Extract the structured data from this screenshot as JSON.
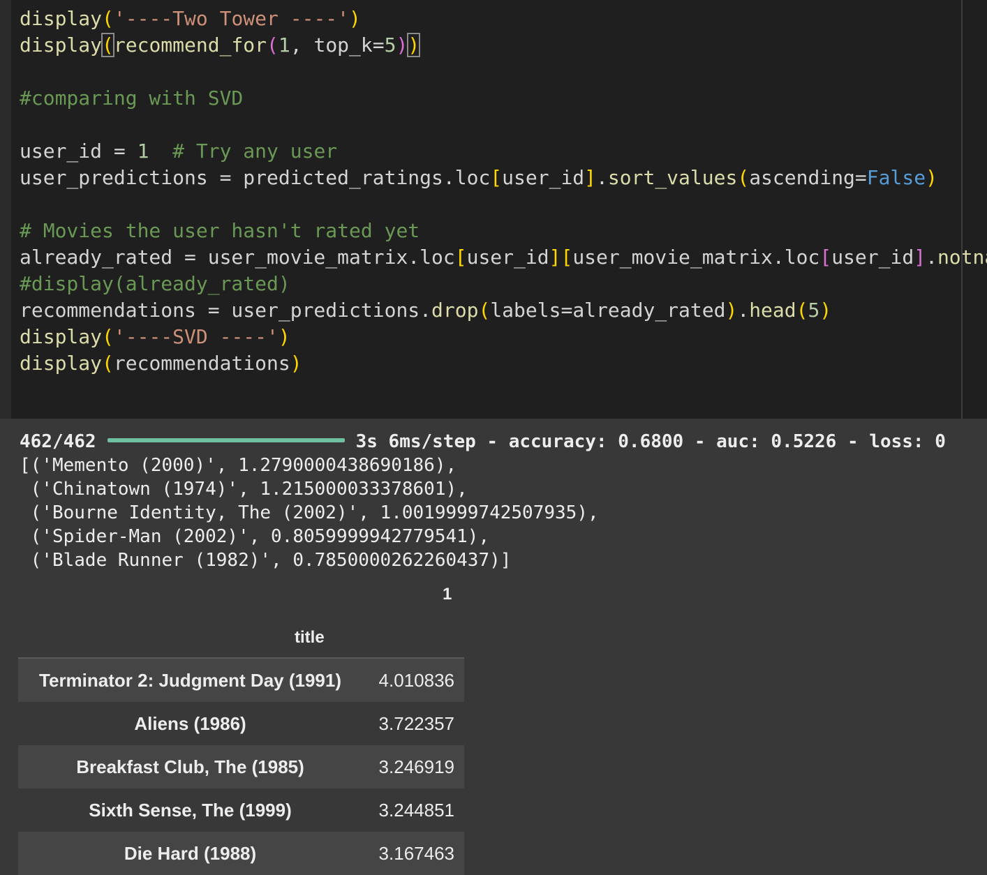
{
  "code_lines": [
    [
      [
        "t-fn",
        "display"
      ],
      [
        "t-p",
        "("
      ],
      [
        "t-s",
        "'----Two Tower ----'"
      ],
      [
        "t-p",
        ")"
      ]
    ],
    [
      [
        "t-fn",
        "display"
      ],
      [
        "t-p cursor-box",
        "("
      ],
      [
        "t-fn",
        "recommend_for"
      ],
      [
        "t-pm",
        "("
      ],
      [
        "t-n",
        "1"
      ],
      [
        "t-id",
        ", top_k="
      ],
      [
        "t-n",
        "5"
      ],
      [
        "t-pm",
        ")"
      ],
      [
        "t-p cursor-box",
        ")"
      ]
    ],
    [],
    [
      [
        "t-c",
        "#comparing with SVD"
      ]
    ],
    [],
    [
      [
        "t-id",
        "user_id = "
      ],
      [
        "t-n",
        "1"
      ],
      [
        "t-id",
        "  "
      ],
      [
        "t-c",
        "# Try any user"
      ]
    ],
    [
      [
        "t-id",
        "user_predictions = predicted_ratings.loc"
      ],
      [
        "t-p",
        "["
      ],
      [
        "t-id",
        "user_id"
      ],
      [
        "t-p",
        "]"
      ],
      [
        "t-id",
        "."
      ],
      [
        "t-fn",
        "sort_values"
      ],
      [
        "t-p",
        "("
      ],
      [
        "t-id",
        "ascending="
      ],
      [
        "t-k",
        "False"
      ],
      [
        "t-p",
        ")"
      ]
    ],
    [],
    [
      [
        "t-c",
        "# Movies the user hasn't rated yet"
      ]
    ],
    [
      [
        "t-id",
        "already_rated = user_movie_matrix.loc"
      ],
      [
        "t-p",
        "["
      ],
      [
        "t-id",
        "user_id"
      ],
      [
        "t-p",
        "]"
      ],
      [
        "t-p",
        "["
      ],
      [
        "t-id",
        "user_movie_matrix.loc"
      ],
      [
        "t-pm",
        "["
      ],
      [
        "t-id",
        "user_id"
      ],
      [
        "t-pm",
        "]"
      ],
      [
        "t-id",
        "."
      ],
      [
        "t-fn",
        "notna"
      ]
    ],
    [
      [
        "t-c",
        "#display(already_rated)"
      ]
    ],
    [
      [
        "t-id",
        "recommendations = user_predictions."
      ],
      [
        "t-fn",
        "drop"
      ],
      [
        "t-p",
        "("
      ],
      [
        "t-id",
        "labels=already_rated"
      ],
      [
        "t-p",
        ")"
      ],
      [
        "t-id",
        "."
      ],
      [
        "t-fn",
        "head"
      ],
      [
        "t-p",
        "("
      ],
      [
        "t-n",
        "5"
      ],
      [
        "t-p",
        ")"
      ]
    ],
    [
      [
        "t-fn",
        "display"
      ],
      [
        "t-p",
        "("
      ],
      [
        "t-s",
        "'----SVD ----'"
      ],
      [
        "t-p",
        ")"
      ]
    ],
    [
      [
        "t-fn",
        "display"
      ],
      [
        "t-p",
        "("
      ],
      [
        "t-id",
        "recommendations"
      ],
      [
        "t-p",
        ")"
      ]
    ]
  ],
  "progress": {
    "steps": "462/462",
    "fraction": 1.0,
    "stats": "3s 6ms/step - accuracy: 0.6800 - auc: 0.5226 - loss: 0"
  },
  "stdout_lines": [
    "[('Memento (2000)', 1.2790000438690186),",
    " ('Chinatown (1974)', 1.215000033378601),",
    " ('Bourne Identity, The (2002)', 1.0019999742507935),",
    " ('Spider-Man (2002)', 0.8059999942779541),",
    " ('Blade Runner (1982)', 0.7850000262260437)]"
  ],
  "dataframe": {
    "column_header": "1",
    "index_name": "title",
    "rows": [
      {
        "title": "Terminator 2: Judgment Day (1991)",
        "value": "4.010836"
      },
      {
        "title": "Aliens (1986)",
        "value": "3.722357"
      },
      {
        "title": "Breakfast Club, The (1985)",
        "value": "3.246919"
      },
      {
        "title": "Sixth Sense, The (1999)",
        "value": "3.244851"
      },
      {
        "title": "Die Hard (1988)",
        "value": "3.167463"
      }
    ]
  }
}
